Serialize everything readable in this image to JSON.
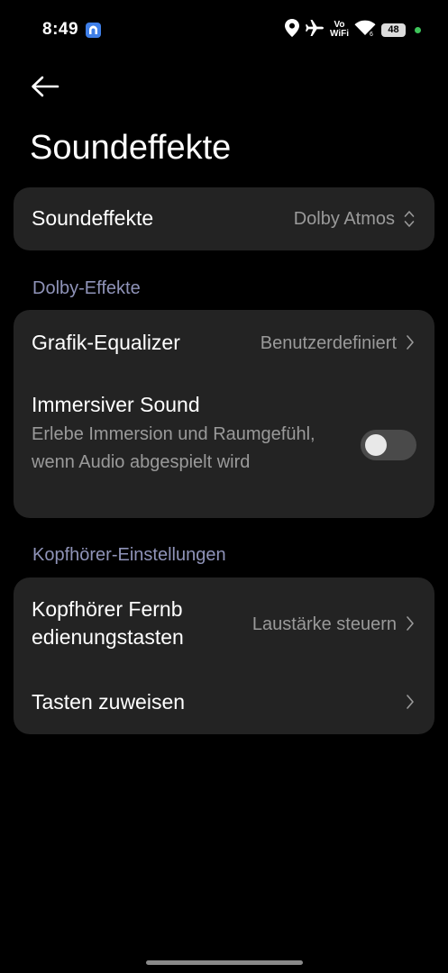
{
  "status_bar": {
    "time": "8:49",
    "volte_line1": "Vo",
    "volte_line2": "WiFi",
    "battery": "48"
  },
  "page": {
    "title": "Soundeffekte"
  },
  "sound_effects_card": {
    "label": "Soundeffekte",
    "value": "Dolby Atmos"
  },
  "dolby_section": {
    "header": "Dolby-Effekte",
    "equalizer_label": "Grafik-Equalizer",
    "equalizer_value": "Benutzerdefiniert",
    "immersive_label": "Immersiver Sound",
    "immersive_desc": "Erlebe Immersion und Raumgefühl, wenn Audio abgespielt wird",
    "immersive_enabled": false
  },
  "headphone_section": {
    "header": "Kopfhörer-Einstellungen",
    "remote_label_line1": "Kopfhörer Fernb",
    "remote_label_line2": "edienungstasten",
    "remote_value": "Laustärke steuern",
    "assign_label": "Tasten zuweisen"
  }
}
